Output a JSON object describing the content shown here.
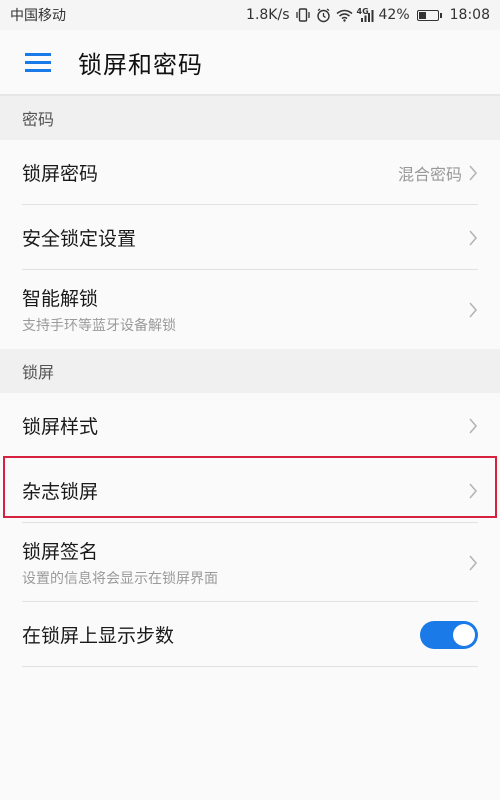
{
  "status": {
    "carrier": "中国移动",
    "speed": "1.8K/s",
    "network": "4G",
    "battery": "42%",
    "battery_level": 0.42,
    "time": "18:08"
  },
  "header": {
    "title": "锁屏和密码",
    "menu_icon": "hamburger-menu-icon"
  },
  "sections": {
    "password": {
      "header": "密码",
      "lock_password": {
        "title": "锁屏密码",
        "value": "混合密码"
      },
      "security_lock": {
        "title": "安全锁定设置"
      },
      "smart_unlock": {
        "title": "智能解锁",
        "subtitle": "支持手环等蓝牙设备解锁"
      }
    },
    "lockscreen": {
      "header": "锁屏",
      "style": {
        "title": "锁屏样式"
      },
      "magazine": {
        "title": "杂志锁屏"
      },
      "signature": {
        "title": "锁屏签名",
        "subtitle": "设置的信息将会显示在锁屏界面"
      },
      "steps": {
        "title": "在锁屏上显示步数",
        "enabled": true
      }
    }
  },
  "colors": {
    "accent": "#1a7ae8",
    "highlight": "#d6213f"
  }
}
